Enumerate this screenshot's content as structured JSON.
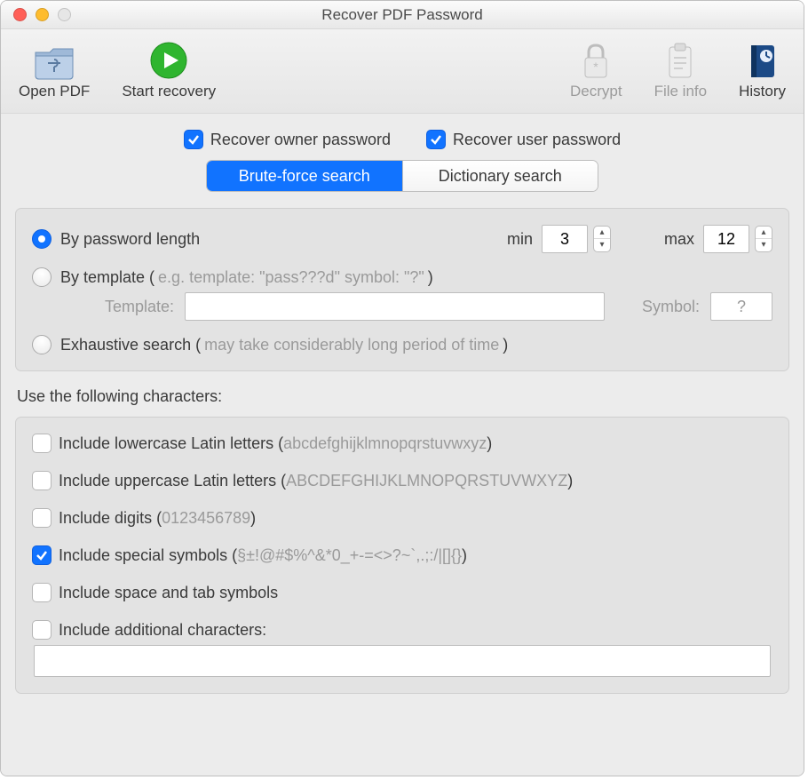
{
  "window": {
    "title": "Recover PDF Password"
  },
  "toolbar": {
    "open_pdf": "Open PDF",
    "start_recovery": "Start recovery",
    "decrypt": "Decrypt",
    "file_info": "File info",
    "history": "History"
  },
  "recover_options": {
    "owner": {
      "label": "Recover owner password",
      "checked": true
    },
    "user": {
      "label": "Recover user password",
      "checked": true
    }
  },
  "tabs": {
    "brute": "Brute-force search",
    "dict": "Dictionary search",
    "active": "brute"
  },
  "search_mode": {
    "by_length": {
      "label": "By password length",
      "selected": true,
      "min_label": "min",
      "min_value": "3",
      "max_label": "max",
      "max_value": "12"
    },
    "by_template": {
      "label": "By template (",
      "hint": "e.g. template: \"pass???d\" symbol: \"?\"",
      "label_close": ")",
      "selected": false,
      "template_label": "Template:",
      "template_value": "",
      "symbol_label": "Symbol:",
      "symbol_value": "?"
    },
    "exhaustive": {
      "label": "Exhaustive search (",
      "hint": "may take considerably long period of time",
      "label_close": ")",
      "selected": false
    }
  },
  "charset": {
    "title": "Use the following characters:",
    "lowercase": {
      "label": "Include lowercase Latin letters (",
      "hint": "abcdefghijklmnopqrstuvwxyz",
      "close": ")",
      "checked": false
    },
    "uppercase": {
      "label": "Include uppercase Latin letters (",
      "hint": "ABCDEFGHIJKLMNOPQRSTUVWXYZ",
      "close": ")",
      "checked": false
    },
    "digits": {
      "label": "Include digits (",
      "hint": "0123456789",
      "close": ")",
      "checked": false
    },
    "special": {
      "label": "Include special symbols (",
      "hint": "§±!@#$%^&*0_+-=<>?~`,.;:/|[]{}",
      "close": ")",
      "checked": true
    },
    "space": {
      "label": "Include space and tab symbols",
      "checked": false
    },
    "additional": {
      "label": "Include additional characters:",
      "checked": false,
      "value": ""
    }
  }
}
